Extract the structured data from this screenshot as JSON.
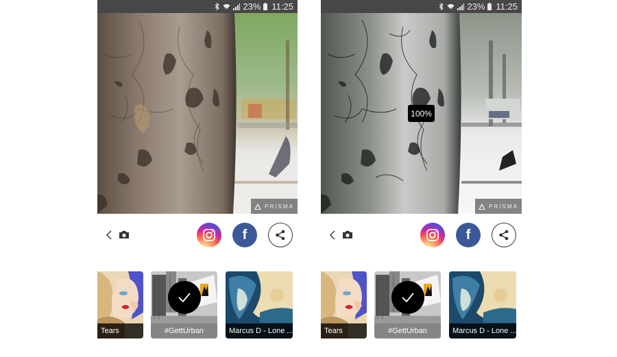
{
  "screens": [
    {
      "id": "original",
      "status_bar": {
        "icons": [
          "bluetooth-icon",
          "wifi-icon",
          "signal-icon",
          "battery-icon"
        ],
        "battery_percent": "23%",
        "time": "11:25"
      },
      "photo": {
        "subject": "tree bark close-up with street background",
        "style": "original"
      },
      "watermark": "PRISMA",
      "actions": {
        "back_icon": "chevron-left-icon",
        "camera_icon": "camera-icon",
        "share_targets": [
          {
            "name": "Instagram",
            "icon": "instagram-icon",
            "color": "#d6249f"
          },
          {
            "name": "Facebook",
            "icon": "facebook-icon",
            "glyph": "f",
            "color": "#3b5998"
          },
          {
            "name": "Share",
            "icon": "share-icon",
            "color": "#333333"
          }
        ]
      },
      "filters": [
        {
          "label": "Tears",
          "selected": false
        },
        {
          "label": "#GettUrban",
          "selected": true
        },
        {
          "label": "Marcus D - Lone ...",
          "selected": false
        }
      ]
    },
    {
      "id": "styled",
      "status_bar": {
        "icons": [
          "bluetooth-icon",
          "wifi-icon",
          "signal-icon",
          "battery-icon"
        ],
        "battery_percent": "23%",
        "time": "11:25"
      },
      "photo": {
        "subject": "tree bark close-up with street background",
        "style": "#GettUrban filter applied"
      },
      "intensity": "100%",
      "watermark": "PRISMA",
      "actions": {
        "back_icon": "chevron-left-icon",
        "camera_icon": "camera-icon",
        "share_targets": [
          {
            "name": "Instagram",
            "icon": "instagram-icon",
            "color": "#d6249f"
          },
          {
            "name": "Facebook",
            "icon": "facebook-icon",
            "glyph": "f",
            "color": "#3b5998"
          },
          {
            "name": "Share",
            "icon": "share-icon",
            "color": "#333333"
          }
        ]
      },
      "filters": [
        {
          "label": "Tears",
          "selected": false
        },
        {
          "label": "#GettUrban",
          "selected": true
        },
        {
          "label": "Marcus D - Lone ...",
          "selected": false
        }
      ]
    }
  ]
}
